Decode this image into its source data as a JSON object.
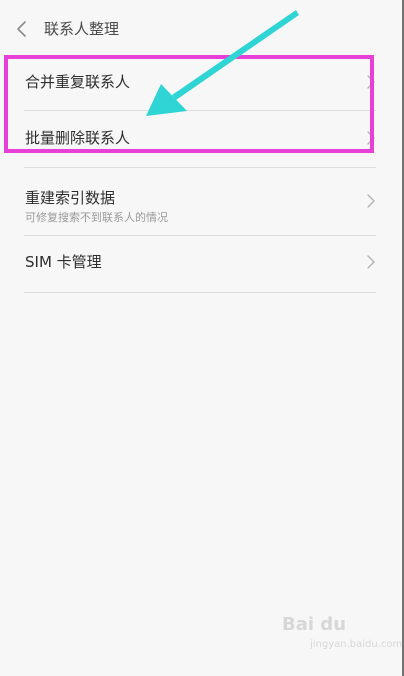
{
  "header": {
    "title": "联系人整理",
    "back_icon": "chevron-left-icon"
  },
  "settings_list": {
    "items": [
      {
        "label": "合并重复联系人",
        "icon": "chevron-right-icon"
      },
      {
        "label": "批量删除联系人",
        "icon": "chevron-right-icon"
      },
      {
        "label": "重建索引数据",
        "subtitle": "可修复搜索不到联系人的情况",
        "icon": "chevron-right-icon"
      },
      {
        "label": "SIM 卡管理",
        "icon": "chevron-right-icon"
      }
    ]
  },
  "annotation": {
    "highlight_color": "#e83fd8",
    "arrow_color": "#2fd4d4"
  },
  "watermark": {
    "logo": "Bai du",
    "caption": "jingyan.baidu.com"
  },
  "colors": {
    "background": "#f7f7f7",
    "divider": "#dcdcdc",
    "text_primary": "#2e2e2e",
    "text_secondary": "#9a9a9a"
  }
}
